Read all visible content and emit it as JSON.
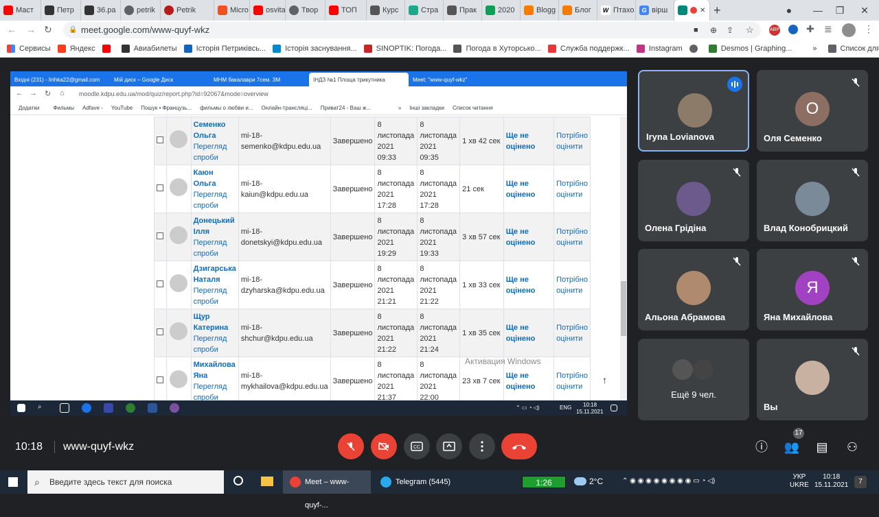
{
  "browser": {
    "tabs": [
      "Маст",
      "Петр",
      "36.ра",
      "petrik",
      "Petrik",
      "Micro",
      "osvita",
      "Твор",
      "ТОП",
      "Курс",
      "Стра",
      "Прак",
      "2020",
      "Blogg",
      "Блог",
      "Птахо",
      "вірш",
      ""
    ],
    "new_tab": "+",
    "url": "meet.google.com/www-quyf-wkz",
    "bookmarks": [
      "Сервисы",
      "Яндекс",
      "",
      "Авиабилеты",
      "Історія Петриківсь...",
      "Історія заснування...",
      "SINOPTIK: Погода...",
      "Погода в Хуторсько...",
      "Служба поддержк...",
      "Instagram",
      "",
      "Desmos | Graphing..."
    ],
    "bookmarks_more": "»",
    "reading_list": "Список для чтения"
  },
  "shared": {
    "tabs": [
      "Вхідні (231) - lirihka22@gmail.com",
      "Мій диск – Google Диск",
      "МНМ бакалаври 7сем. ЗМ",
      "ІНДЗ №1 Площа трикутника",
      "Meet: \"www-quyf-wkz\""
    ],
    "url": "moodle.kdpu.edu.ua/mod/quiz/report.php?id=92067&mode=overview",
    "bookmarks": [
      "Додатки",
      "Фильмы",
      "Adfave -",
      "YouTube",
      "Пошук • Французь...",
      "фильмы о любви и...",
      "Онлайн-трансляці...",
      "Приват24 - Ваш ж...",
      "»",
      "Інші закладки",
      "Список читання"
    ],
    "rows": [
      {
        "name": "Семенко Ольга",
        "link": "Перегляд спроби",
        "email": "mi-18-semenko@kdpu.edu.ua",
        "status": "Завершено",
        "start": "8 листопада 2021 09:33",
        "end": "8 листопада 2021 09:35",
        "time": "1 хв 42 сек",
        "grade": "Ще не оцінено",
        "review": "Потрібно оцінити"
      },
      {
        "name": "Каюн Ольга",
        "link": "Перегляд спроби",
        "email": "mi-18-kaiun@kdpu.edu.ua",
        "status": "Завершено",
        "start": "8 листопада 2021 17:28",
        "end": "8 листопада 2021 17:28",
        "time": "21 сек",
        "grade": "Ще не оцінено",
        "review": "Потрібно оцінити"
      },
      {
        "name": "Донецький Ілля",
        "link": "Перегляд спроби",
        "email": "mi-18-donetskyi@kdpu.edu.ua",
        "status": "Завершено",
        "start": "8 листопада 2021 19:29",
        "end": "8 листопада 2021 19:33",
        "time": "3 хв 57 сек",
        "grade": "Ще не оцінено",
        "review": "Потрібно оцінити"
      },
      {
        "name": "Дзигарська Наталя",
        "link": "Перегляд спроби",
        "email": "mi-18-dzyharska@kdpu.edu.ua",
        "status": "Завершено",
        "start": "8 листопада 2021 21:21",
        "end": "8 листопада 2021 21:22",
        "time": "1 хв 33 сек",
        "grade": "Ще не оцінено",
        "review": "Потрібно оцінити"
      },
      {
        "name": "Щур Катерина",
        "link": "Перегляд спроби",
        "email": "mi-18-shchur@kdpu.edu.ua",
        "status": "Завершено",
        "start": "8 листопада 2021 21:22",
        "end": "8 листопада 2021 21:24",
        "time": "1 хв 35 сек",
        "grade": "Ще не оцінено",
        "review": "Потрібно оцінити"
      },
      {
        "name": "Михайлова Яна",
        "link": "Перегляд спроби",
        "email": "mi-18-mykhailova@kdpu.edu.ua",
        "status": "Завершено",
        "start": "8 листопада 2021 21:37",
        "end": "8 листопада 2021 22:00",
        "time": "23 хв 7 сек",
        "grade": "Ще не оцінено",
        "review": "Потрібно оцінити"
      }
    ],
    "watermark": "Активация Windows",
    "taskbar": {
      "lang": "ENG",
      "time": "10:18",
      "date": "15.11.2021"
    }
  },
  "participants": [
    {
      "name": "Iryna Lovianova",
      "type": "photo",
      "speaking": true
    },
    {
      "name": "Оля Семенко",
      "type": "letter",
      "letter": "О",
      "color": "#8d6e63"
    },
    {
      "name": "Олена Грідіна",
      "type": "photo"
    },
    {
      "name": "Влад Конобрицкий",
      "type": "photo"
    },
    {
      "name": "Альона Абрамова",
      "type": "photo"
    },
    {
      "name": "Яна Михайлова",
      "type": "letter",
      "letter": "Я",
      "color": "#a142c3"
    },
    {
      "name": "Ещё 9 чел.",
      "type": "group"
    },
    {
      "name": "Вы",
      "type": "photo"
    }
  ],
  "controls": {
    "time": "10:18",
    "code": "www-quyf-wkz",
    "people_count": "17"
  },
  "taskbar": {
    "search_placeholder": "Введите здесь текст для поиска",
    "apps": [
      "Meet – www-quyf-...",
      "Telegram (5445)"
    ],
    "timer": "1:26",
    "weather": "2°C",
    "lang": "УКР",
    "lang2": "UKRE",
    "time": "10:18",
    "date": "15.11.2021",
    "notifications": "7"
  }
}
